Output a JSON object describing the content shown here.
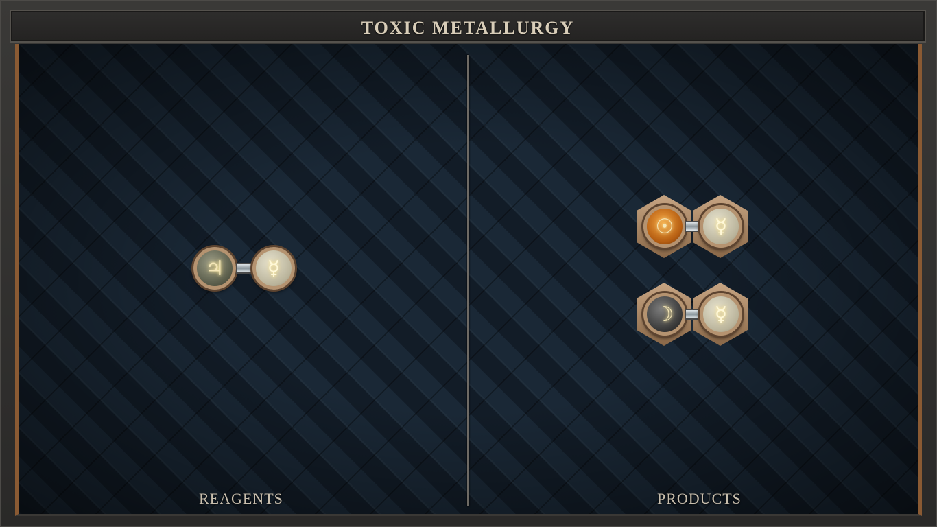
{
  "title": "TOXIC METALLURGY",
  "panels": {
    "reagents": {
      "label": "REAGENTS",
      "molecules": [
        {
          "atoms": [
            {
              "element": "tin",
              "symbol": "♃"
            },
            {
              "element": "quicksilver",
              "symbol": "☿"
            }
          ]
        }
      ]
    },
    "products": {
      "label": "PRODUCTS",
      "molecules": [
        {
          "atoms": [
            {
              "element": "gold",
              "symbol": "☉"
            },
            {
              "element": "quicksilver",
              "symbol": "☿"
            }
          ]
        },
        {
          "atoms": [
            {
              "element": "silver",
              "symbol": "☽"
            },
            {
              "element": "quicksilver",
              "symbol": "☿"
            }
          ]
        }
      ]
    }
  },
  "colors": {
    "frame_accent": "#8a5a33",
    "board": "#15202c",
    "text": "#c9bfae"
  }
}
